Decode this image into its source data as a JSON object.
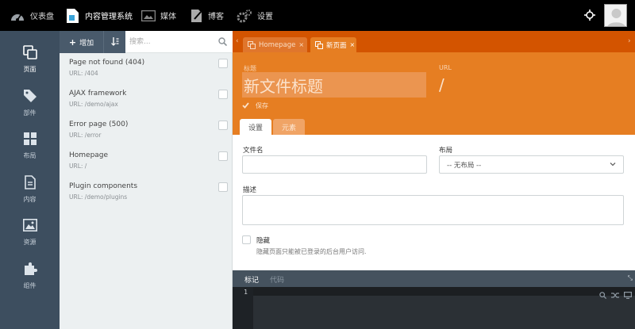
{
  "topbar": {
    "nav": [
      {
        "label": "仪表盘",
        "icon": "dashboard-icon"
      },
      {
        "label": "内容管理系统",
        "icon": "cms-icon"
      },
      {
        "label": "媒体",
        "icon": "media-icon"
      },
      {
        "label": "博客",
        "icon": "blog-icon"
      },
      {
        "label": "设置",
        "icon": "settings-icon"
      }
    ]
  },
  "sidebar": {
    "items": [
      {
        "label": "页面",
        "icon": "pages-icon"
      },
      {
        "label": "部件",
        "icon": "partials-icon"
      },
      {
        "label": "布局",
        "icon": "layouts-icon"
      },
      {
        "label": "内容",
        "icon": "content-icon"
      },
      {
        "label": "资源",
        "icon": "assets-icon"
      },
      {
        "label": "组件",
        "icon": "components-icon"
      }
    ]
  },
  "pagelist": {
    "add_label": "增加",
    "search_placeholder": "搜索...",
    "items": [
      {
        "title": "Page not found (404)",
        "url": "URL: /404"
      },
      {
        "title": "AJAX framework",
        "url": "URL: /demo/ajax"
      },
      {
        "title": "Error page (500)",
        "url": "URL: /error"
      },
      {
        "title": "Homepage",
        "url": "URL: /"
      },
      {
        "title": "Plugin components",
        "url": "URL: /demo/plugins"
      }
    ]
  },
  "editor": {
    "tabs": [
      {
        "label": "Homepage"
      },
      {
        "label": "新页面"
      }
    ],
    "title_label": "标题",
    "title_value": "新文件标题",
    "url_label": "URL",
    "url_value": "/",
    "save_label": "保存",
    "form_tabs": [
      "设置",
      "元素"
    ],
    "filename_label": "文件名",
    "filename_value": "",
    "layout_label": "布局",
    "layout_value": "-- 无布局 --",
    "description_label": "描述",
    "hidden_label": "隐藏",
    "hidden_help": "隐藏页面只能被已登录的后台用户访问.",
    "code_tabs": [
      "标记",
      "代码"
    ],
    "line_number": "1"
  },
  "colors": {
    "accent_orange": "#e67e22",
    "tabstrip_orange": "#d35400",
    "sidebar": "#3d4e5f"
  }
}
